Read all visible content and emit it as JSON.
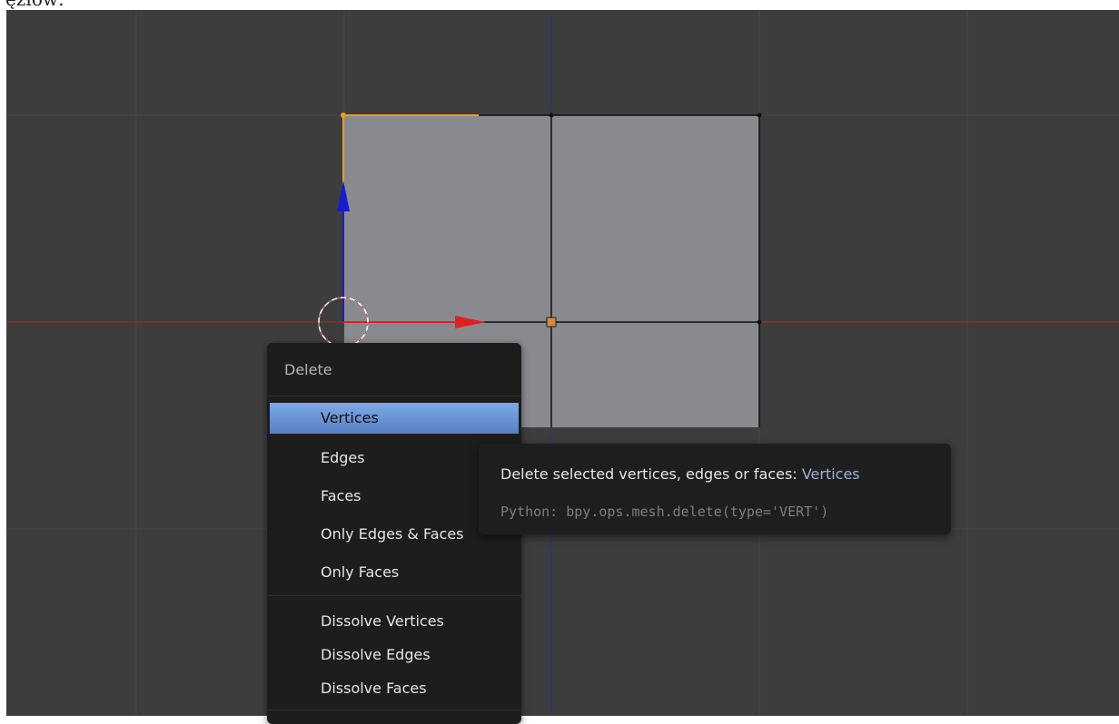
{
  "caption": "ęzłów:",
  "menu": {
    "title": "Delete",
    "items": [
      {
        "label": "Vertices",
        "active": true
      },
      {
        "label": "Edges",
        "active": false
      },
      {
        "label": "Faces",
        "active": false
      },
      {
        "label": "Only Edges & Faces",
        "active": false
      },
      {
        "label": "Only Faces",
        "active": false
      },
      {
        "label": "Dissolve Vertices",
        "active": false
      },
      {
        "label": "Dissolve Edges",
        "active": false
      },
      {
        "label": "Dissolve Faces",
        "active": false
      }
    ]
  },
  "tooltip": {
    "description": "Delete selected vertices, edges or faces:",
    "value": "Vertices",
    "python": "Python: bpy.ops.mesh.delete(type='VERT')"
  },
  "colors": {
    "viewport_bg": "#3d3d3d",
    "mesh_face": "#898a8f",
    "selected_edge": "#f09a20",
    "x_axis": "#c42020",
    "z_axis": "#2020b0",
    "menu_highlight": "#6b93d6"
  }
}
